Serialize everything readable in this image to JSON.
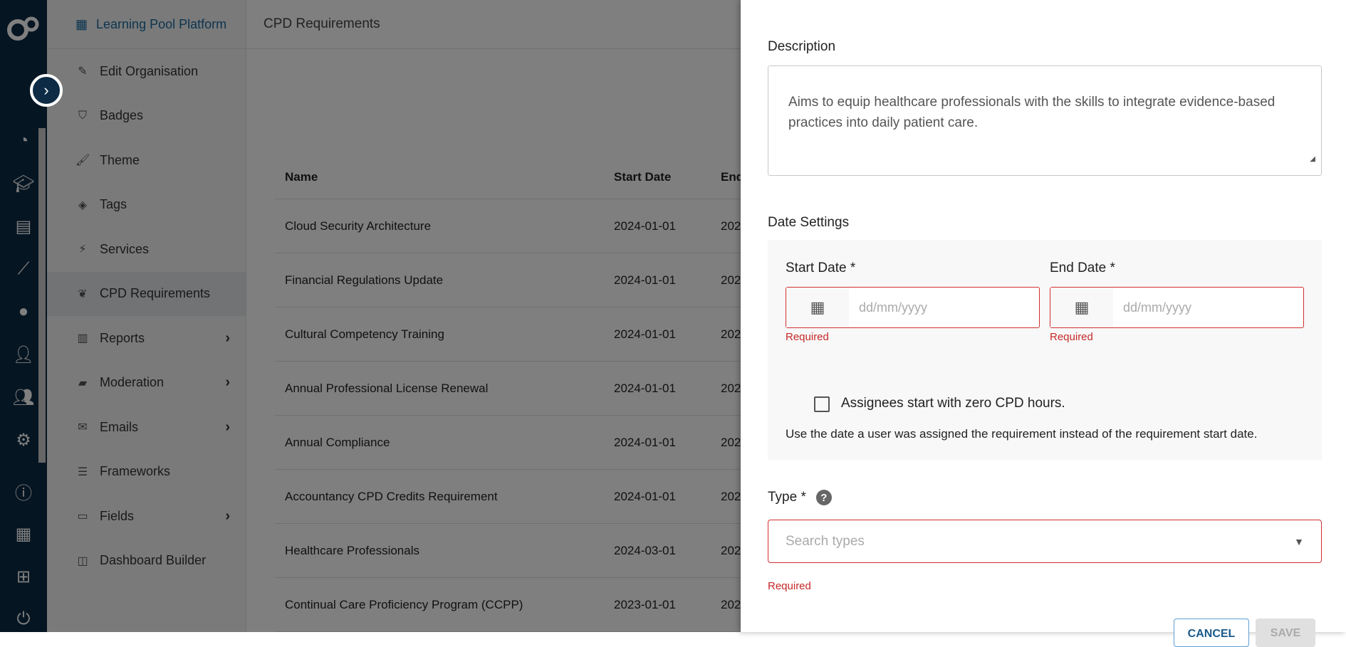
{
  "sidebar": {
    "brand": "Learning Pool Platform",
    "items": [
      {
        "label": "Edit Organisation",
        "icon": "pencil-icon",
        "chev": false
      },
      {
        "label": "Badges",
        "icon": "shield-icon",
        "chev": false
      },
      {
        "label": "Theme",
        "icon": "brush-icon",
        "chev": false
      },
      {
        "label": "Tags",
        "icon": "tags-icon",
        "chev": false
      },
      {
        "label": "Services",
        "icon": "plug-icon",
        "chev": false
      },
      {
        "label": "CPD Requirements",
        "icon": "seedling-icon",
        "chev": false,
        "active": true
      },
      {
        "label": "Reports",
        "icon": "bar-chart-icon",
        "chev": true
      },
      {
        "label": "Moderation",
        "icon": "eraser-icon",
        "chev": true
      },
      {
        "label": "Emails",
        "icon": "envelope-icon",
        "chev": true
      },
      {
        "label": "Frameworks",
        "icon": "list-icon",
        "chev": false
      },
      {
        "label": "Fields",
        "icon": "form-icon",
        "chev": true
      },
      {
        "label": "Dashboard Builder",
        "icon": "columns-icon",
        "chev": false
      }
    ]
  },
  "header": {
    "title": "CPD Requirements"
  },
  "table": {
    "headers": [
      "Name",
      "Start Date",
      "End"
    ],
    "rows": [
      [
        "Cloud Security Architecture",
        "2024-01-01",
        "202"
      ],
      [
        "Financial Regulations Update",
        "2024-01-01",
        "202"
      ],
      [
        "Cultural Competency Training",
        "2024-01-01",
        "202"
      ],
      [
        "Annual Professional License Renewal",
        "2024-01-01",
        "202"
      ],
      [
        "Annual Compliance",
        "2024-01-01",
        "202"
      ],
      [
        "Accountancy CPD Credits Requirement",
        "2024-01-01",
        "202"
      ],
      [
        "Healthcare Professionals",
        "2024-03-01",
        "202"
      ],
      [
        "Continual Care Proficiency Program (CCPP)",
        "2023-01-01",
        "202"
      ]
    ]
  },
  "panel": {
    "description_label": "Description",
    "description_value": "Aims to equip healthcare professionals with the skills to integrate evidence-based practices into daily patient care.",
    "date_settings_label": "Date Settings",
    "start_date_label": "Start Date *",
    "end_date_label": "End Date *",
    "date_placeholder": "dd/mm/yyyy",
    "required": "Required",
    "checkbox_label": "Assignees start with zero CPD hours.",
    "checkbox_help": "Use the date a user was assigned the requirement instead of the requirement start date.",
    "type_label": "Type *",
    "type_placeholder": "Search types",
    "cancel": "CANCEL",
    "save": "SAVE"
  },
  "colors": {
    "rail": "#0d2b45",
    "error": "#d32f2f",
    "link": "#1a6aa0"
  }
}
